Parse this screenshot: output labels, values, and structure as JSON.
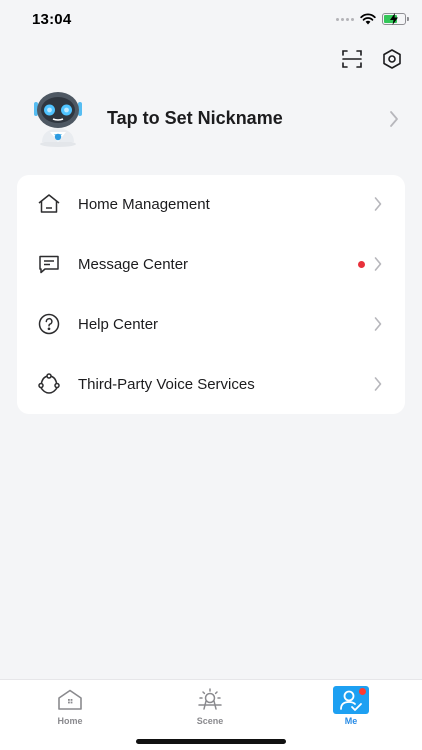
{
  "status_bar": {
    "time": "13:04"
  },
  "top_actions": {
    "scan_icon": "scan-icon",
    "settings_icon": "settings-hexagon-icon"
  },
  "profile": {
    "nickname": "Tap to Set Nickname",
    "avatar_icon": "robot-avatar-icon"
  },
  "menu": {
    "items": [
      {
        "label": "Home Management",
        "icon": "house-icon"
      },
      {
        "label": "Message Center",
        "icon": "message-icon",
        "has_unread_dot": true
      },
      {
        "label": "Help Center",
        "icon": "question-circle-icon"
      },
      {
        "label": "Third-Party Voice Services",
        "icon": "voice-services-icon"
      }
    ]
  },
  "tab_bar": {
    "tabs": [
      {
        "label": "Home",
        "icon": "home-tab-icon",
        "active": false
      },
      {
        "label": "Scene",
        "icon": "scene-tab-icon",
        "active": false
      },
      {
        "label": "Me",
        "icon": "me-tab-icon",
        "active": true
      }
    ]
  },
  "colors": {
    "accent": "#2a8ce6",
    "me_tab_bg": "#1da0f2",
    "unread_dot": "#e8313b",
    "background": "#f4f5f7",
    "card": "#ffffff"
  }
}
